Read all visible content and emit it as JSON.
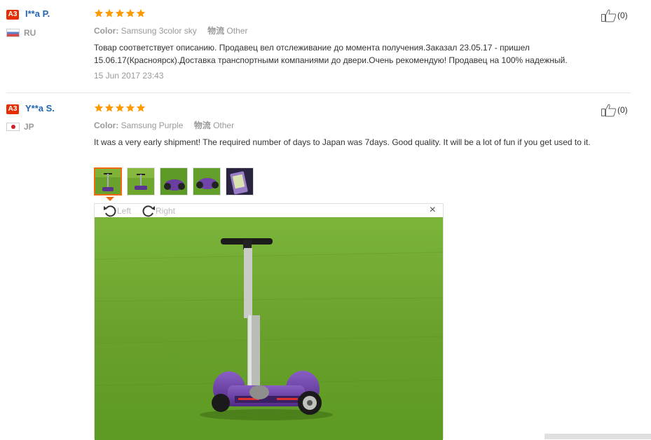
{
  "reviews": [
    {
      "badge": "A3",
      "user": "I**a P.",
      "country": "RU",
      "rating": 5,
      "color_label": "Color:",
      "color_value": "Samsung 3color sky",
      "ship_label": "物流",
      "ship_value": "Other",
      "text": "Товар соответствует описанию. Продавец вел отслеживание до момента получения.Заказал 23.05.17 - пришел 15.06.17(Красноярск).Доставка транспортными компаниями до двери.Очень рекомендую! Продавец на 100% надежный.",
      "date": "15 Jun 2017 23:43",
      "likes": "(0)"
    },
    {
      "badge": "A3",
      "user": "Y**a S.",
      "country": "JP",
      "rating": 5,
      "color_label": "Color:",
      "color_value": "Samsung Purple",
      "ship_label": "物流",
      "ship_value": "Other",
      "text": "It was a very early shipment! The required number of days to Japan was 7days. Good quality. It will be a lot of fun if you get used to it.",
      "likes": "(0)"
    }
  ],
  "viewer": {
    "rotate_left": "Left",
    "rotate_right": "Right",
    "close": "×"
  },
  "colors": {
    "accent": "#f26a10",
    "star": "#ff9900",
    "username": "#2266b3",
    "badge": "#e62e04",
    "grass": "#6aa12c",
    "scooter": "#6b3fa0"
  }
}
